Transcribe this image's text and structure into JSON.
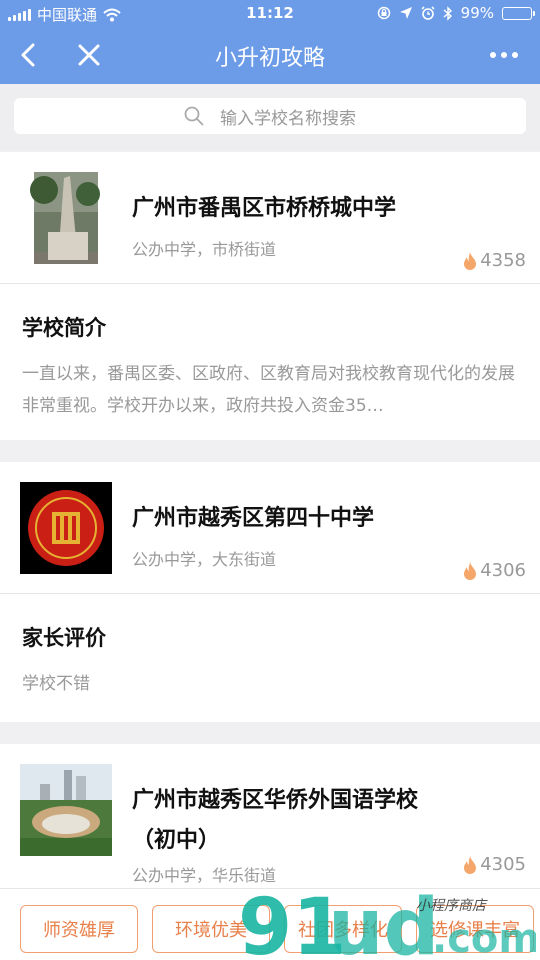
{
  "status_bar": {
    "carrier": "中国联通",
    "time": "11:12",
    "battery": "99%",
    "battery_level": 0.99
  },
  "nav": {
    "title": "小升初攻略",
    "back_icon": "chevron-left-icon",
    "close_icon": "close-icon",
    "more_icon": "more-dots-icon"
  },
  "search": {
    "placeholder": "输入学校名称搜索"
  },
  "schools": [
    {
      "name": "广州市番禺区市桥桥城中学",
      "meta": "公办中学，市桥街道",
      "hot": "4358",
      "section_title": "学校简介",
      "section_text": "一直以来，番禺区委、区政府、区教育局对我校教育现代化的发展非常重视。学校开办以来，政府共投入资金35…"
    },
    {
      "name": "广州市越秀区第四十中学",
      "meta": "公办中学，大东街道",
      "hot": "4306",
      "section_title": "家长评价",
      "section_text": "学校不错"
    },
    {
      "name": "广州市越秀区华侨外国语学校",
      "name_line2": "（初中）",
      "meta": "公办中学，华乐街道",
      "hot": "4305"
    }
  ],
  "tags": [
    "师资雄厚",
    "环境优美",
    "社团多样化",
    "选修课丰富"
  ],
  "watermark": {
    "text": "91ud.com",
    "sub": "小程序商店"
  },
  "colors": {
    "nav_bg": "#6c9be8",
    "tag_color": "#e8804a",
    "hot_icon": "#f5a66a"
  }
}
